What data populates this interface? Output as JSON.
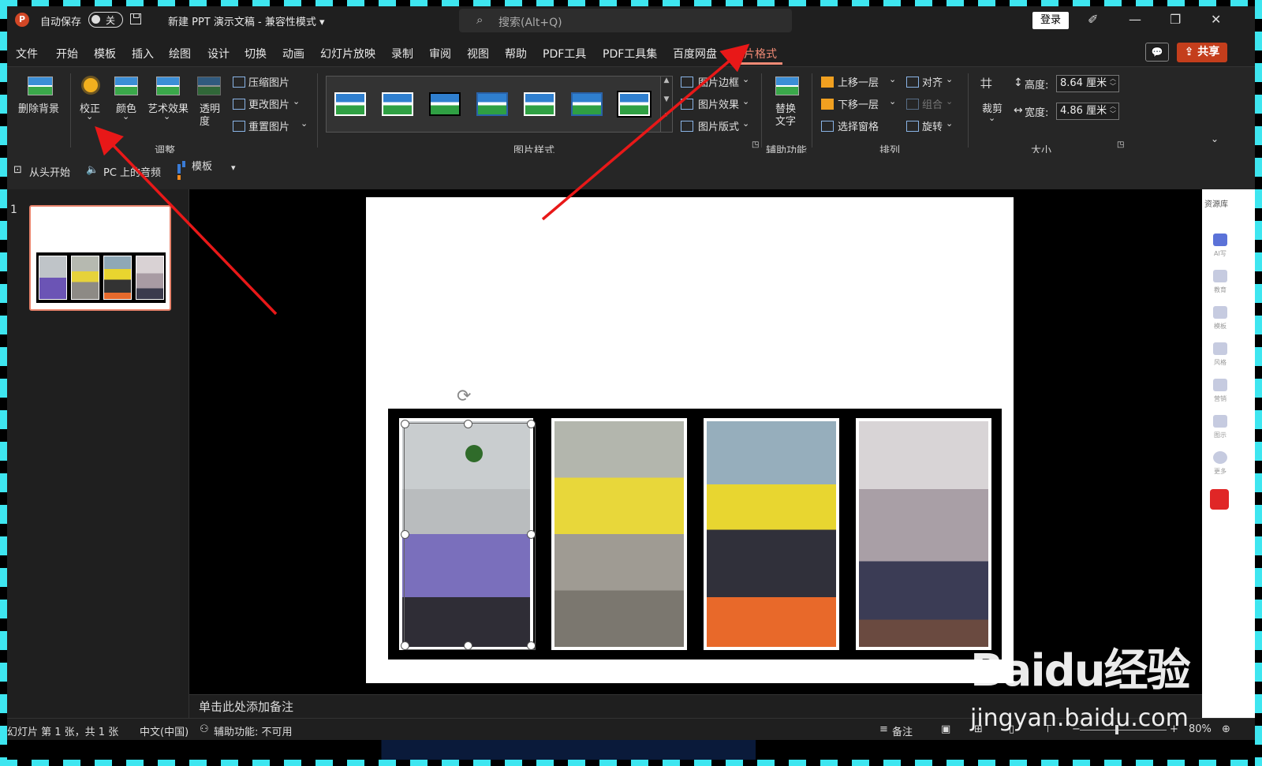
{
  "titlebar": {
    "app_icon": "P",
    "autosave_label": "自动保存",
    "autosave_state": "关",
    "doc_title": "新建 PPT 演示文稿 - 兼容性模式 ▾",
    "search_placeholder": "搜索(Alt+Q)",
    "login": "登录",
    "pen_icon": "✐",
    "minimize": "—",
    "restore": "❐",
    "close": "✕"
  },
  "menu": {
    "tabs": [
      "文件",
      "开始",
      "模板",
      "插入",
      "绘图",
      "设计",
      "切换",
      "动画",
      "幻灯片放映",
      "录制",
      "审阅",
      "视图",
      "帮助",
      "PDF工具",
      "PDF工具集",
      "百度网盘",
      "图片格式"
    ],
    "comment_icon": "💬",
    "share": "共享"
  },
  "ribbon": {
    "remove_bg": "删除背景",
    "corrections": "校正",
    "color": "颜色",
    "art_effects": "艺术效果",
    "transparency_1": "透明",
    "transparency_2": "度",
    "compress": "压缩图片",
    "change": "更改图片",
    "reset": "重置图片",
    "group_adjust": "调整",
    "group_styles": "图片样式",
    "border": "图片边框",
    "effects": "图片效果",
    "layout": "图片版式",
    "alt_text_1": "替换",
    "alt_text_2": "文字",
    "group_access": "辅助功能",
    "bring_forward": "上移一层",
    "send_backward": "下移一层",
    "selection_pane": "选择窗格",
    "align": "对齐",
    "group_btn": "组合",
    "rotate": "旋转",
    "group_arrange": "排列",
    "crop": "裁剪",
    "height_label": "高度:",
    "height_value": "8.64 厘米",
    "width_label": "宽度:",
    "width_value": "4.86 厘米",
    "group_size": "大小",
    "chevron": "⌄"
  },
  "quick": {
    "from_start": "从头开始",
    "pc_audio": "PC 上的音频",
    "template": "模板",
    "more": "▾"
  },
  "thumbs": {
    "slide_number": "1"
  },
  "notes": {
    "placeholder": "单击此处添加备注"
  },
  "side_panel": {
    "title": "资源库",
    "items": [
      "AI写",
      "教育",
      "模板",
      "风格",
      "营销",
      "图示",
      "更多"
    ]
  },
  "status": {
    "slide_info": "幻灯片 第 1 张，共 1 张",
    "language": "中文(中国)",
    "accessibility": "辅助功能: 不可用",
    "notes_btn": "备注",
    "zoom": "80%",
    "minus": "−",
    "plus": "+"
  },
  "watermark": {
    "brand": "Baidu经验",
    "url": "jingyan.baidu.com"
  },
  "colors": {
    "accent": "#f08a75",
    "share": "#c43e1c",
    "arrow": "#e81818",
    "frame": "#3ee6f0"
  }
}
